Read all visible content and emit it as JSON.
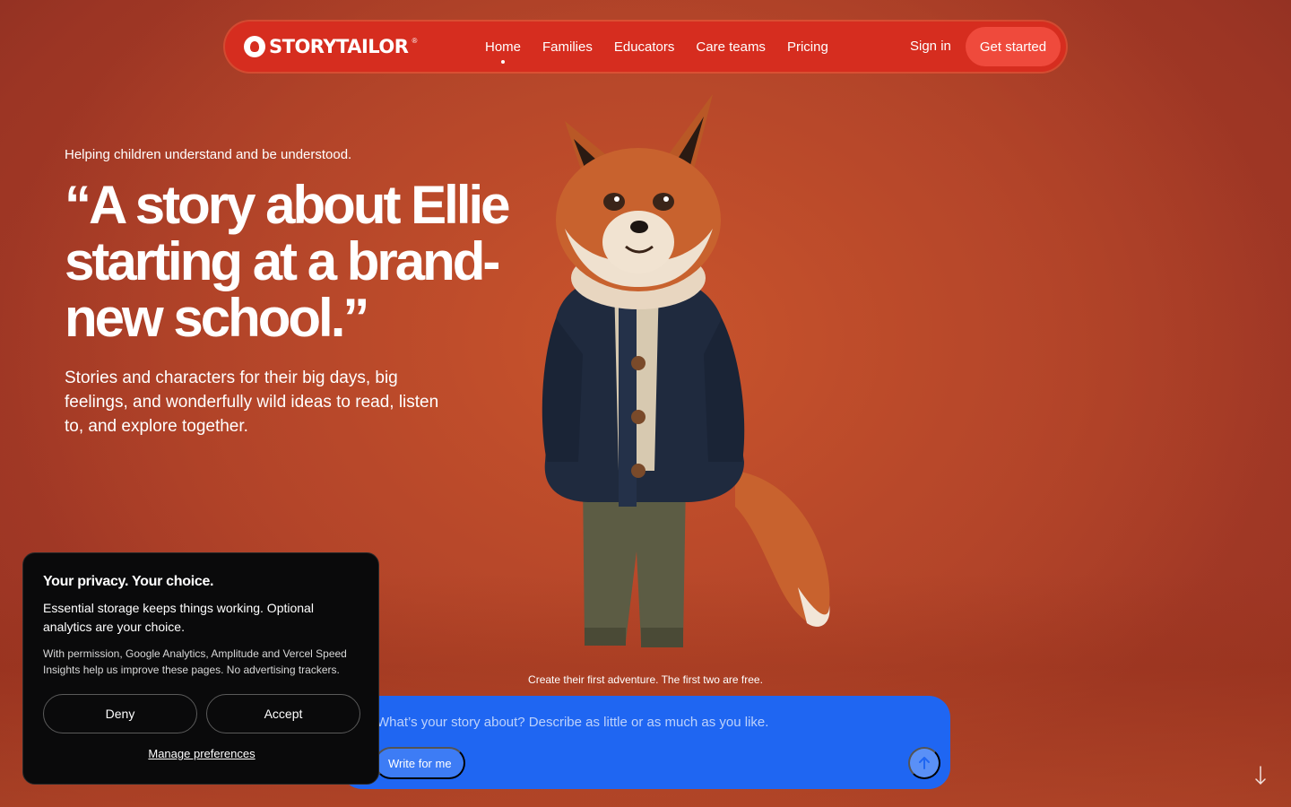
{
  "nav": {
    "logo_text": "STORYTAILOR",
    "logo_reg": "®",
    "links": [
      {
        "label": "Home",
        "active": true
      },
      {
        "label": "Families"
      },
      {
        "label": "Educators"
      },
      {
        "label": "Care teams"
      },
      {
        "label": "Pricing"
      }
    ],
    "sign_in": "Sign in",
    "get_started": "Get started"
  },
  "hero": {
    "eyebrow": "Helping children understand and be understood.",
    "headline": "“A story about Ellie starting at a brand-new school.”",
    "subtext": "Stories and characters for their big days, big feelings, and wonderfully wild ideas to read, listen to, and explore together."
  },
  "prompt": {
    "caption": "Create their first adventure. The first two are free.",
    "placeholder": "What’s your story about? Describe as little or as much as you like.",
    "write_for_me": "Write for me",
    "send_icon": "arrow-up-icon",
    "scroll_icon": "arrow-down-icon"
  },
  "cookie": {
    "title": "Your privacy. Your choice.",
    "lead": "Essential storage keeps things working. Optional analytics are your choice.",
    "fine": "With permission, Google Analytics, Amplitude and Vercel Speed Insights help us improve these pages. No advertising trackers.",
    "deny": "Deny",
    "accept": "Accept",
    "manage": "Manage preferences"
  },
  "colors": {
    "nav_bg": "#d62d1f",
    "prompt_bg": "#1f66f2",
    "cookie_bg": "#0a0a0b"
  }
}
